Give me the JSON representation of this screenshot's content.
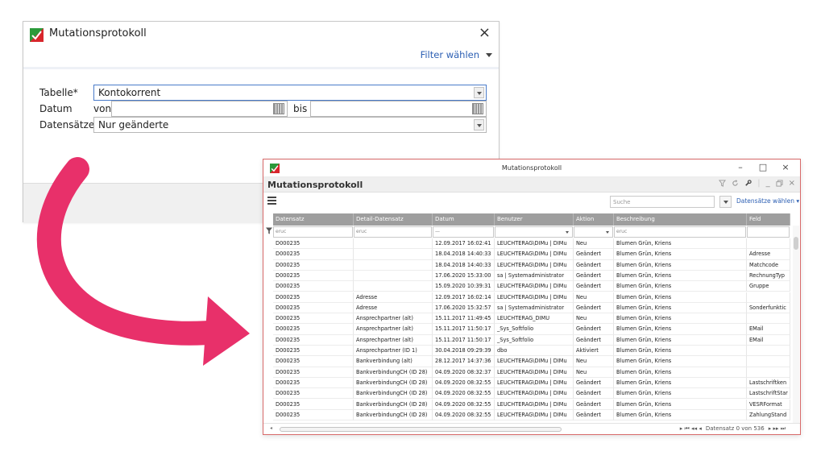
{
  "dialog": {
    "title": "Mutationsprotokoll",
    "close_glyph": "×",
    "filter_link": "Filter wählen",
    "rows": {
      "tabelle_label": "Tabelle*",
      "tabelle_value": "Kontokorrent",
      "datum_label": "Datum",
      "von_label": "von",
      "bis_label": "bis",
      "datensaetze_label": "Datensätze*",
      "datensaetze_value": "Nur geänderte"
    }
  },
  "window": {
    "titlebar_text": "Mutationsprotokoll",
    "minimize_glyph": "–",
    "maximize_glyph": "□",
    "close_glyph": "×",
    "header_title": "Mutationsprotokoll",
    "header_icons": [
      "filter-icon",
      "refresh-icon",
      "wrench-icon",
      "minimize-icon",
      "restore-icon",
      "close-icon"
    ],
    "search_placeholder": "Suche",
    "datensaetze_waehlen": "Datensätze wählen",
    "columns": [
      "Datensatz",
      "Detail-Datensatz",
      "Datum",
      "Benutzer",
      "Aktion",
      "Beschreibung",
      "Feld"
    ],
    "filter_hints": [
      "eruc",
      "eruc",
      "—",
      "",
      "",
      "eruc",
      ""
    ],
    "rows": [
      [
        "D000235",
        "",
        "12.09.2017 16:02:41",
        "LEUCHTERAG\\DIMu  |  DIMu",
        "Neu",
        "Blumen Grün, Kriens",
        ""
      ],
      [
        "D000235",
        "",
        "18.04.2018 14:40:33",
        "LEUCHTERAG\\DIMu  |  DIMu",
        "Geändert",
        "Blumen Grün, Kriens",
        "Adresse"
      ],
      [
        "D000235",
        "",
        "18.04.2018 14:40:33",
        "LEUCHTERAG\\DIMu  |  DIMu",
        "Geändert",
        "Blumen Grün, Kriens",
        "Matchcode"
      ],
      [
        "D000235",
        "",
        "17.06.2020 15:33:00",
        "sa  |  Systemadministrator",
        "Geändert",
        "Blumen Grün, Kriens",
        "RechnungTyp"
      ],
      [
        "D000235",
        "",
        "15.09.2020 10:39:31",
        "LEUCHTERAG\\DIMu  |  DIMu",
        "Geändert",
        "Blumen Grün, Kriens",
        "Gruppe"
      ],
      [
        "D000235",
        "Adresse",
        "12.09.2017 16:02:14",
        "LEUCHTERAG\\DIMu  |  DIMu",
        "Neu",
        "Blumen Grün, Kriens",
        ""
      ],
      [
        "D000235",
        "Adresse",
        "17.06.2020 15:32:57",
        "sa  |  Systemadministrator",
        "Geändert",
        "Blumen Grün, Kriens",
        "Sonderfunktic"
      ],
      [
        "D000235",
        "Ansprechpartner (alt)",
        "15.11.2017 11:49:45",
        "LEUCHTERAG_DIMU",
        "Neu",
        "Blumen Grün, Kriens",
        ""
      ],
      [
        "D000235",
        "Ansprechpartner (alt)",
        "15.11.2017 11:50:17",
        "_Sys_Softfolio",
        "Geändert",
        "Blumen Grün, Kriens",
        "EMail"
      ],
      [
        "D000235",
        "Ansprechpartner (alt)",
        "15.11.2017 11:50:17",
        "_Sys_Softfolio",
        "Geändert",
        "Blumen Grün, Kriens",
        "EMail"
      ],
      [
        "D000235",
        "Ansprechpartner (ID 1)",
        "30.04.2018 09:29:39",
        "dbo",
        "Aktiviert",
        "Blumen Grün, Kriens",
        ""
      ],
      [
        "D000235",
        "Bankverbindung (alt)",
        "28.12.2017 14:37:36",
        "LEUCHTERAG\\DIMu  |  DIMu",
        "Neu",
        "Blumen Grün, Kriens",
        ""
      ],
      [
        "D000235",
        "BankverbindungCH (ID 28)",
        "04.09.2020 08:32:37",
        "LEUCHTERAG\\DIMu  |  DIMu",
        "Neu",
        "Blumen Grün, Kriens",
        ""
      ],
      [
        "D000235",
        "BankverbindungCH (ID 28)",
        "04.09.2020 08:32:55",
        "LEUCHTERAG\\DIMu  |  DIMu",
        "Geändert",
        "Blumen Grün, Kriens",
        "Lastschriftken"
      ],
      [
        "D000235",
        "BankverbindungCH (ID 28)",
        "04.09.2020 08:32:55",
        "LEUCHTERAG\\DIMu  |  DIMu",
        "Geändert",
        "Blumen Grün, Kriens",
        "LastschriftStar"
      ],
      [
        "D000235",
        "BankverbindungCH (ID 28)",
        "04.09.2020 08:32:55",
        "LEUCHTERAG\\DIMu  |  DIMu",
        "Geändert",
        "Blumen Grün, Kriens",
        "VESRFormat"
      ],
      [
        "D000235",
        "BankverbindungCH (ID 28)",
        "04.09.2020 08:32:55",
        "LEUCHTERAG\\DIMu  |  DIMu",
        "Geändert",
        "Blumen Grün, Kriens",
        "ZahlungStand"
      ]
    ],
    "pager_text": "Datensatz 0 von 536",
    "pager_nav_left": "▸ ⏮ ◂◂ ◂",
    "pager_nav_right": "▸ ▸▸ ⏭"
  },
  "colors": {
    "accent_link": "#2c5fb3",
    "arrow": "#e8306a",
    "grid_header": "#9e9e9e",
    "window_border": "#d86a6a"
  }
}
